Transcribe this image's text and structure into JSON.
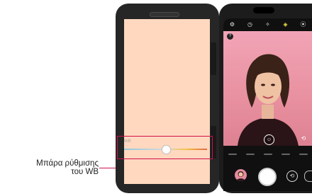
{
  "callout": {
    "line1": "Μπάρα ρύθμισης",
    "line2": "του WB"
  },
  "wb_bar": {
    "tag": "WB",
    "level": 0.5,
    "accent_color": "#d0104c"
  },
  "camera": {
    "top_icons": [
      {
        "name": "settings-icon",
        "glyph": "⚙"
      },
      {
        "name": "timer-icon",
        "glyph": "◷"
      },
      {
        "name": "effects-icon",
        "glyph": "✧"
      },
      {
        "name": "wide-angle-icon",
        "glyph": "◈"
      },
      {
        "name": "mode-icon",
        "glyph": "⦿"
      }
    ],
    "mode_badge": "?",
    "face_glyph": "☺",
    "flip_glyph": "⟲",
    "switch_glyph": "⟲"
  },
  "colors": {
    "case_screen": "#ffd8bf",
    "viewfinder_bg": "#f1a4b6",
    "accent": "#d0104c"
  }
}
